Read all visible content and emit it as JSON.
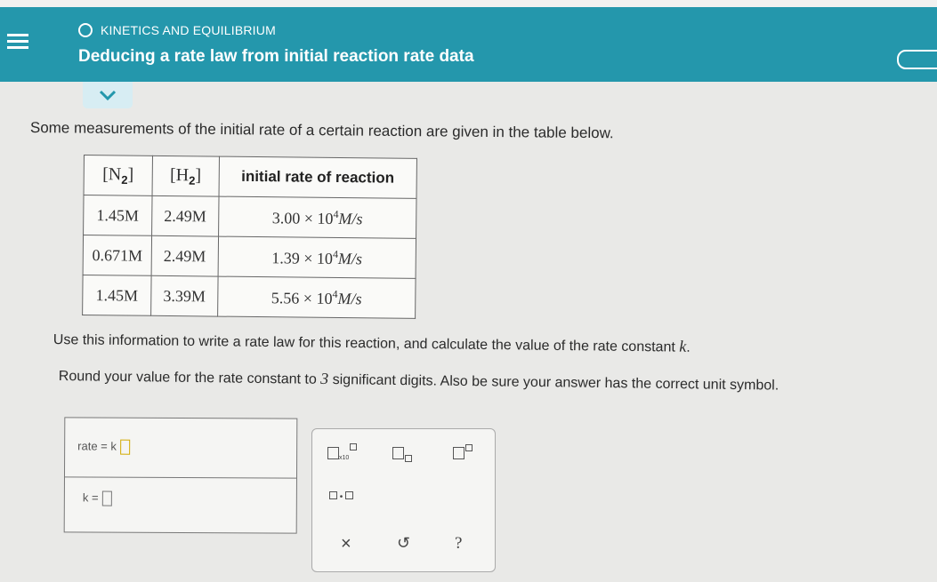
{
  "header": {
    "topic": "KINETICS AND EQUILIBRIUM",
    "title": "Deducing a rate law from initial reaction rate data"
  },
  "problem": {
    "intro": "Some measurements of the initial rate of a certain reaction are given in the table below.",
    "instruction1_pre": "Use this information to write a rate law for this reaction, and calculate the value of the rate constant ",
    "instruction1_k": "k",
    "instruction1_post": ".",
    "instruction2_pre": "Round your value for the rate constant to ",
    "instruction2_num": "3",
    "instruction2_post": " significant digits. Also be sure your answer has the correct unit symbol."
  },
  "table": {
    "headers": {
      "n2_bracket_open": "[",
      "n2_base": "N",
      "n2_sub": "2",
      "n2_bracket_close": "]",
      "h2_bracket_open": "[",
      "h2_base": "H",
      "h2_sub": "2",
      "h2_bracket_close": "]",
      "rate": "initial rate of reaction"
    },
    "rows": [
      {
        "n2": "1.45M",
        "h2": "2.49M",
        "rate_mant": "3.00 × 10",
        "rate_exp": "4",
        "rate_unit": "M/s"
      },
      {
        "n2": "0.671M",
        "h2": "2.49M",
        "rate_mant": "1.39 × 10",
        "rate_exp": "4",
        "rate_unit": "M/s"
      },
      {
        "n2": "1.45M",
        "h2": "3.39M",
        "rate_mant": "5.56 × 10",
        "rate_exp": "4",
        "rate_unit": "M/s"
      }
    ]
  },
  "answer": {
    "rate_label": "rate = k",
    "k_label": "k ="
  },
  "palette": {
    "x10_label": "x10",
    "multiply_dot": "•",
    "clear_symbol": "×",
    "undo_symbol": "↺",
    "help_symbol": "?"
  },
  "colors": {
    "header_bg": "#2497ac",
    "accent_cursor": "#d2aa00"
  }
}
